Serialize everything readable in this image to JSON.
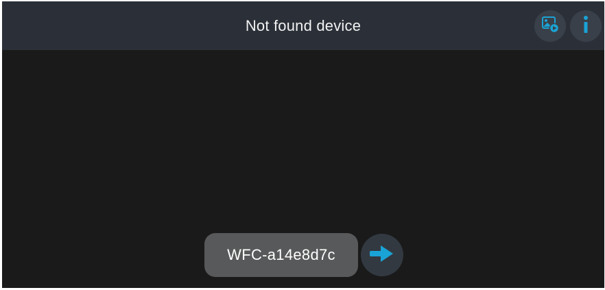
{
  "header": {
    "title": "Not found device"
  },
  "toolbar": {
    "media_icon": "gallery-play-icon",
    "info_icon": "info-icon"
  },
  "device": {
    "name": "WFC-a14e8d7c",
    "go_icon": "arrow-right-icon"
  },
  "colors": {
    "accent": "#1aa3d6",
    "header_bg": "#2b3038",
    "background": "#1a1a1a",
    "pill_bg": "#58595a"
  }
}
